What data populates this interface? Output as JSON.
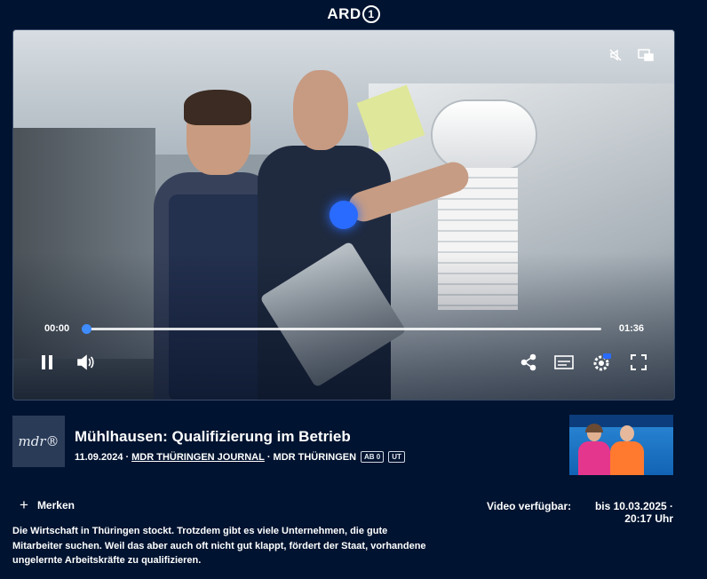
{
  "header": {
    "logo_text": "ARD",
    "logo_number": "1"
  },
  "player": {
    "current_time": "00:00",
    "total_time": "01:36",
    "progress": 0,
    "icons": {
      "mute_top": "speaker-muted-icon",
      "pip": "picture-in-picture-icon",
      "pause": "pause-icon",
      "volume": "volume-icon",
      "share": "share-icon",
      "subtitles": "subtitles-icon",
      "settings": "settings-hd-icon",
      "fullscreen": "fullscreen-icon"
    }
  },
  "video": {
    "channel_logo": "mdr®",
    "title": "Mühlhausen: Qualifizierung im Betrieb",
    "date": "11.09.2024",
    "show_link": "MDR THÜRINGEN JOURNAL",
    "broadcaster": "MDR THÜRINGEN",
    "badges": [
      "AB 0",
      "UT"
    ],
    "separator": "·"
  },
  "actions": {
    "merken_label": "Merken"
  },
  "availability": {
    "label": "Video verfügbar:",
    "value": "bis 10.03.2025 · 20:17 Uhr"
  },
  "description": "Die Wirtschaft in Thüringen stockt. Trotzdem gibt es viele Unternehmen, die gute Mitarbeiter suchen. Weil das aber auch oft nicht gut klappt, fördert der Staat, vorhandene ungelernte Arbeitskräfte zu qualifizieren.",
  "colors": {
    "background": "#001330",
    "accent": "#3f8cff"
  }
}
